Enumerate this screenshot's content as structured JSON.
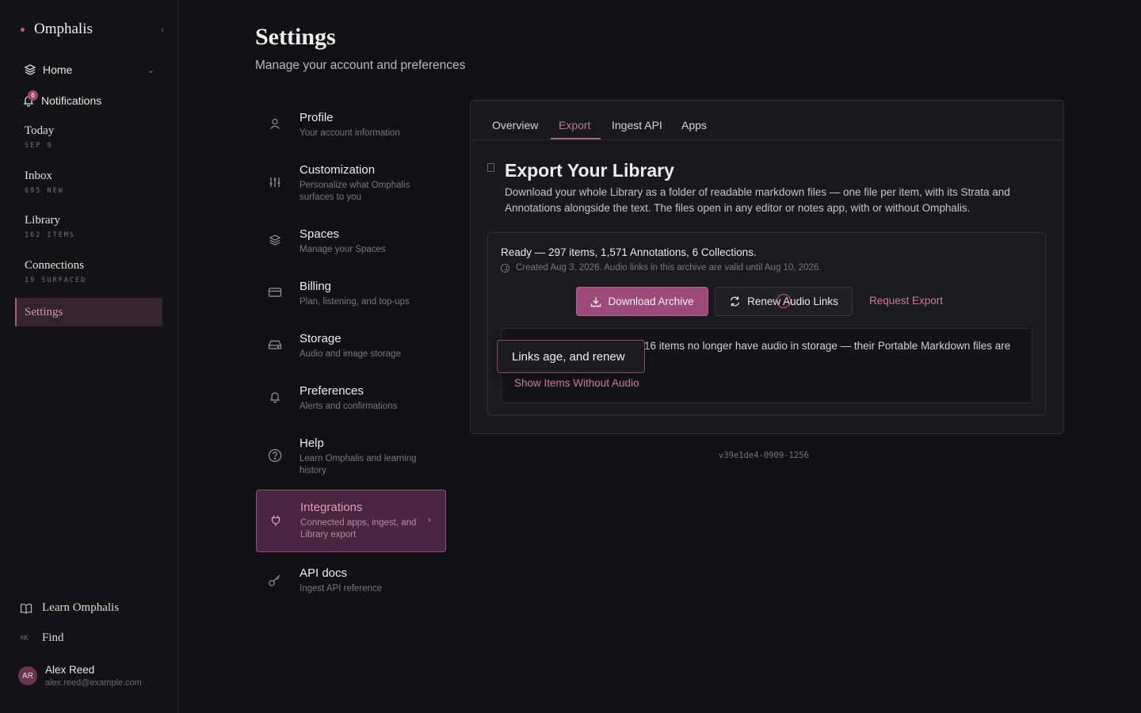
{
  "sidebar": {
    "brand": "Omphalis",
    "home": "Home",
    "notifications": {
      "label": "Notifications",
      "count": "6"
    },
    "items": [
      {
        "label": "Today",
        "sub": "SEP 9"
      },
      {
        "label": "Inbox",
        "sub": "695 NEW"
      },
      {
        "label": "Library",
        "sub": "162 ITEMS"
      },
      {
        "label": "Connections",
        "sub": "19 SURFACED"
      }
    ],
    "settings": "Settings",
    "learn": "Learn Omphalis",
    "find": {
      "label": "Find",
      "shortcut": "⌘K"
    },
    "user": {
      "initials": "AR",
      "name": "Alex Reed",
      "email": "alex.reed@example.com"
    }
  },
  "header": {
    "title": "Settings",
    "subtitle": "Manage your account and preferences"
  },
  "menu": [
    {
      "title": "Profile",
      "desc": "Your account information"
    },
    {
      "title": "Customization",
      "desc": "Personalize what Omphalis surfaces to you"
    },
    {
      "title": "Spaces",
      "desc": "Manage your Spaces"
    },
    {
      "title": "Billing",
      "desc": "Plan, listening, and top-ups"
    },
    {
      "title": "Storage",
      "desc": "Audio and image storage"
    },
    {
      "title": "Preferences",
      "desc": "Alerts and confirmations"
    },
    {
      "title": "Help",
      "desc": "Learn Omphalis and learning history"
    },
    {
      "title": "Integrations",
      "desc": "Connected apps, ingest, and Library export"
    },
    {
      "title": "API docs",
      "desc": "Ingest API reference"
    }
  ],
  "panel": {
    "tabs": [
      "Overview",
      "Export",
      "Ingest API",
      "Apps"
    ],
    "active_tab": "Export",
    "title": "Export Your Library",
    "description": "Download your whole Library as a folder of readable markdown files — one file per item, with its Strata and Annotations alongside the text. The files open in any editor or notes app, with or without Omphalis.",
    "status": "Ready — 297 items, 1,571 Annotations, 6 Collections.",
    "created": "Created Aug 3, 2026. Audio links in this archive are valid until Aug 10, 2026.",
    "download_label": "Download Archive",
    "renew_label": "Renew Audio Links",
    "request_label": "Request Export",
    "notice_text": "16 items no longer have audio in storage — their Portable Markdown files are",
    "notice_link": "Show Items Without Audio",
    "tooltip": "Links age, and renew"
  },
  "version": "v39e1de4-0909-1256",
  "colors": {
    "accent": "#9c4a77",
    "accent_text": "#c97aa0",
    "background": "#111113"
  }
}
